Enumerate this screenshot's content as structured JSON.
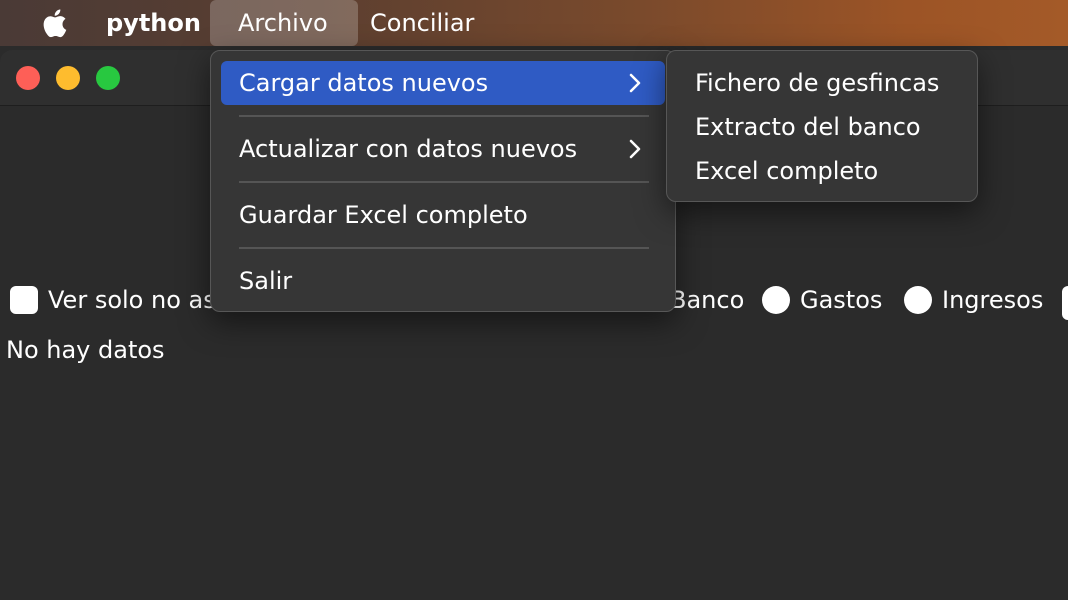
{
  "menubar": {
    "app_name": "python",
    "archivo": "Archivo",
    "conciliar": "Conciliar"
  },
  "window": {
    "filter_checkbox_label": "Ver solo no as",
    "radio_banco": "Banco",
    "radio_gastos": "Gastos",
    "radio_ingresos": "Ingresos",
    "empty_message": "No hay datos"
  },
  "archivo_menu": {
    "items": [
      {
        "label": "Cargar datos nuevos",
        "submenu": true,
        "active": true
      },
      {
        "label": "Actualizar con datos nuevos",
        "submenu": true,
        "active": false
      },
      {
        "label": "Guardar Excel completo",
        "submenu": false,
        "active": false
      },
      {
        "label": "Salir",
        "submenu": false,
        "active": false
      }
    ]
  },
  "cargar_submenu": {
    "items": [
      {
        "label": "Fichero de gesfincas"
      },
      {
        "label": "Extracto del banco"
      },
      {
        "label": "Excel completo"
      }
    ]
  },
  "colors": {
    "menu_highlight": "#2f5bc4",
    "window_bg": "#2b2b2b",
    "close": "#fe5f57",
    "minimize": "#febc2e",
    "zoom": "#28c840"
  },
  "icons": [
    "apple-logo-icon",
    "chevron-right-icon"
  ]
}
